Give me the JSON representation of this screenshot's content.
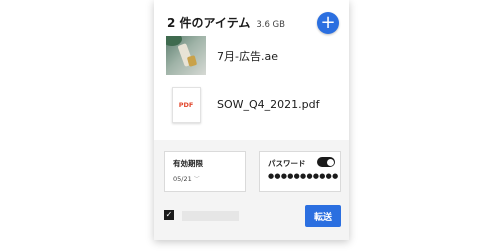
{
  "header": {
    "title": "2 件のアイテム",
    "total_size": "3.6 GB",
    "add_label": "+"
  },
  "files": [
    {
      "name": "7月-広告.ae",
      "type": "image"
    },
    {
      "name": "SOW_Q4_2021.pdf",
      "type": "pdf",
      "icon_label": "PDF"
    }
  ],
  "options": {
    "expiry_label": "有効期限",
    "expiry_value": "05/21",
    "password_label": "パスワード",
    "password_value": "●●●●●●●●●●●",
    "password_enabled": true
  },
  "footer": {
    "checkbox_checked": true,
    "send_label": "転送"
  },
  "colors": {
    "accent": "#2b6fe0",
    "pdf_red": "#e2492f",
    "toggle_on": "#1b1b1b"
  }
}
